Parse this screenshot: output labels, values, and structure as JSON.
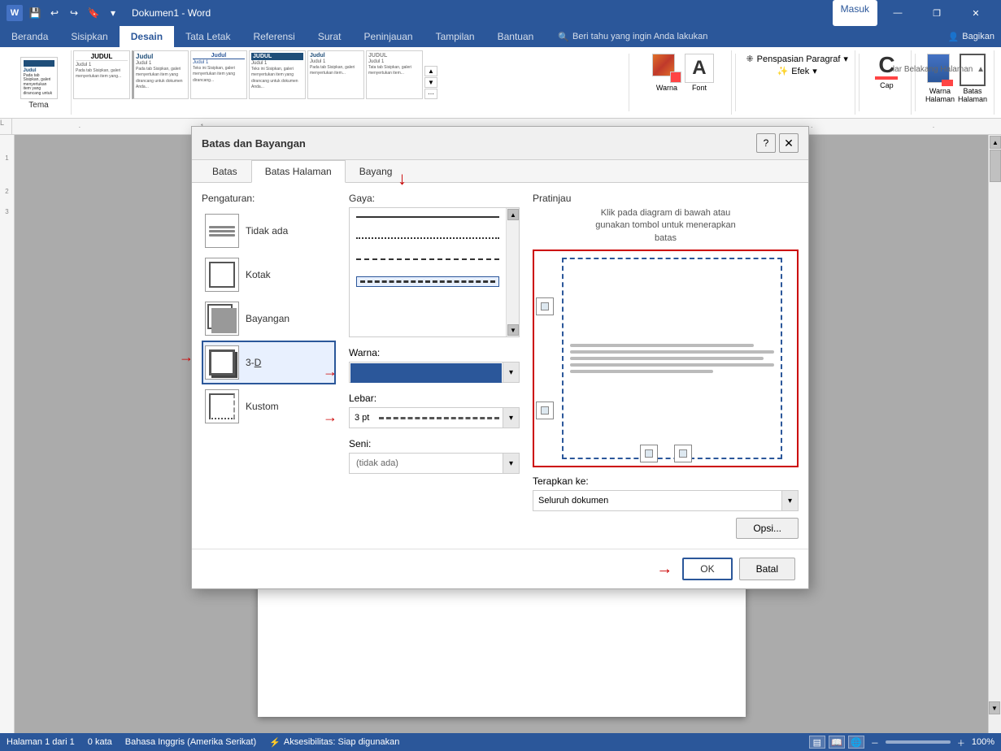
{
  "titlebar": {
    "title": "Dokumen1 - Word",
    "login_btn": "Masuk",
    "minimize": "—",
    "restore": "❐",
    "close": "✕"
  },
  "ribbon": {
    "tabs": [
      "Beranda",
      "Sisipkan",
      "Desain",
      "Tata Letak",
      "Referensi",
      "Surat",
      "Peninjauan",
      "Tampilan",
      "Bantuan"
    ],
    "active_tab": "Desain",
    "tell_me": "Beri tahu yang ingin Anda lakukan",
    "share": "Bagikan",
    "tema_label": "Tema",
    "warna_label": "Warna",
    "font_label": "Font",
    "efek_label": "Efek",
    "penspasian_label": "Penspasian Paragraf",
    "warna_halaman": "Warna\nHalaman",
    "batas_halaman": "Batas\nHalaman",
    "latar_belakang": "lar Belakang Halaman"
  },
  "dialog": {
    "title": "Batas dan Bayangan",
    "help_btn": "?",
    "close_btn": "✕",
    "tabs": [
      "Batas",
      "Batas Halaman",
      "Bayang"
    ],
    "active_tab": "Batas Halaman",
    "settings_label": "Pengaturan:",
    "settings": [
      {
        "id": "tidak-ada",
        "label": "Tidak ada"
      },
      {
        "id": "kotak",
        "label": "Kotak"
      },
      {
        "id": "bayangan",
        "label": "Bayangan"
      },
      {
        "id": "3d",
        "label": "3-D"
      },
      {
        "id": "kustom",
        "label": "Kustom"
      }
    ],
    "gaya_label": "Gaya:",
    "gaya_items": [
      "solid",
      "dotted",
      "dashed",
      "dashdot"
    ],
    "warna_label": "Warna:",
    "warna_value": "Biru",
    "lebar_label": "Lebar:",
    "lebar_value": "3 pt",
    "seni_label": "Seni:",
    "seni_value": "(tidak ada)",
    "preview_label": "Pratinjau",
    "preview_hint": "Klik pada diagram di bawah atau\ngunakan tombol untuk menerapkan\nbatas",
    "terapkan_label": "Terapkan ke:",
    "terapkan_value": "Seluruh dokumen",
    "opsi_btn": "Opsi...",
    "ok_btn": "OK",
    "batal_btn": "Batal"
  },
  "statusbar": {
    "halaman": "Halaman 1 dari 1",
    "kata": "0 kata",
    "bahasa": "Bahasa Inggris (Amerika Serikat)",
    "aksesibilitas": "Aksesibilitas: Siap digunakan",
    "zoom": "100%"
  }
}
